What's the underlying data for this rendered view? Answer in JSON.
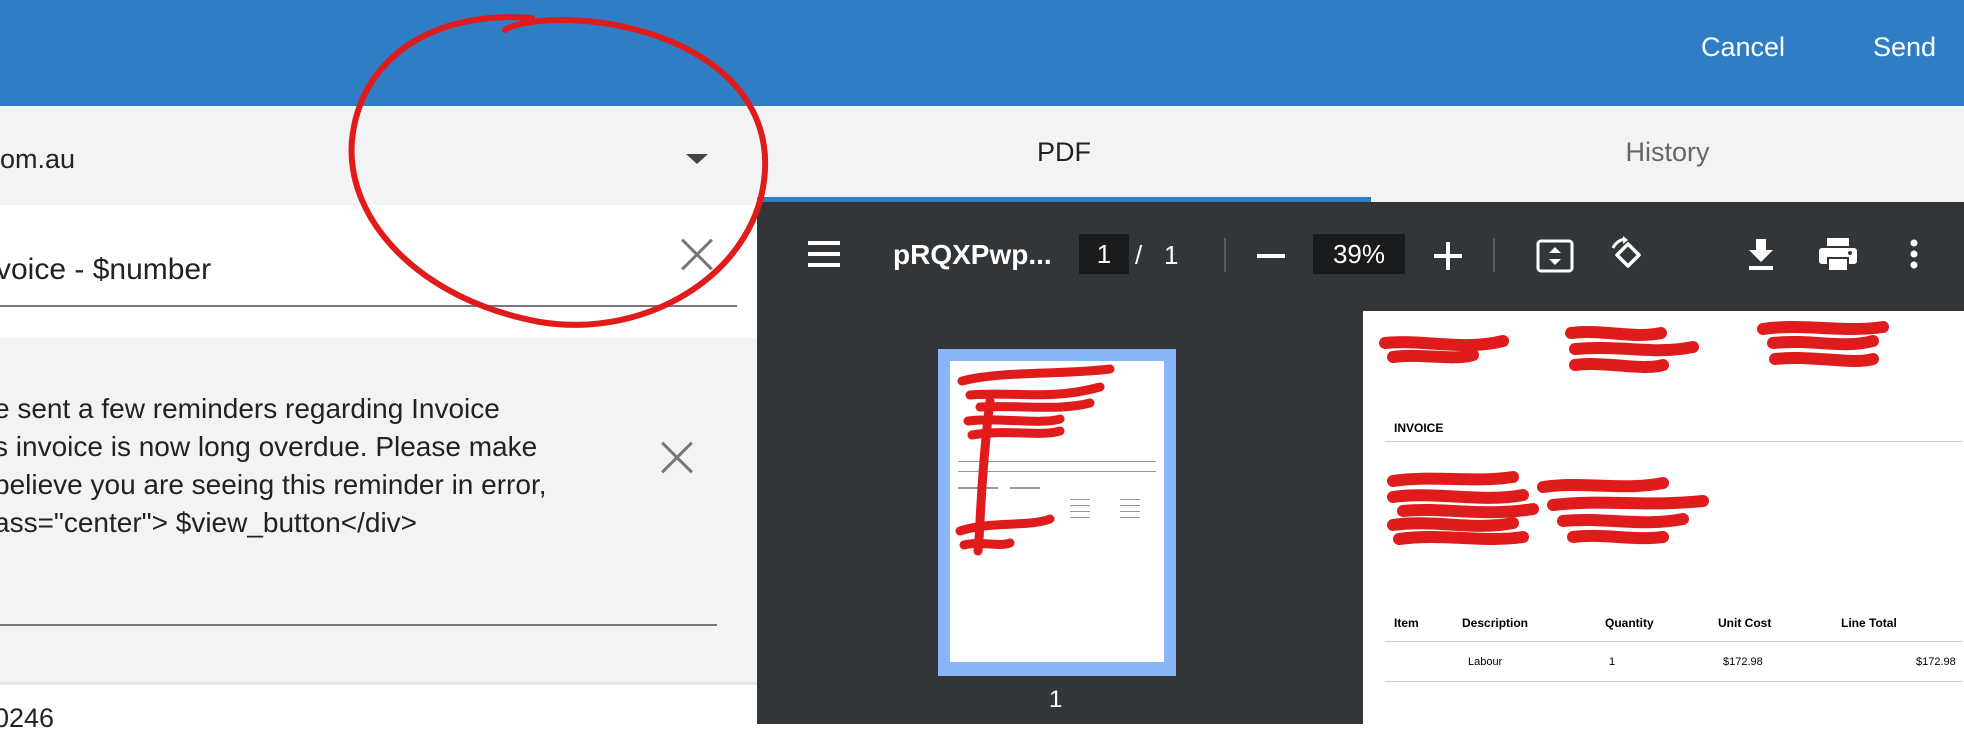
{
  "header": {
    "cancel_label": "Cancel",
    "send_label": "Send"
  },
  "form": {
    "to_value": "om.au",
    "subject_value": "voice - $number",
    "body_text": "e sent a few reminders regarding Invoice\ns invoice is now long overdue. Please make\nbelieve you are seeing this reminder in error,\nass=\"center\"> $view_button</div>",
    "bottom_value": "0246"
  },
  "tabs": [
    {
      "label": "PDF",
      "active": true
    },
    {
      "label": "History",
      "active": false
    }
  ],
  "pdf_viewer": {
    "filename": "pRQXPwp...",
    "page_current": "1",
    "page_separator": "/",
    "page_total": "1",
    "zoom": "39%",
    "thumbnail_page_number": "1",
    "icons": [
      "menu-icon",
      "zoom-out-icon",
      "zoom-in-icon",
      "fit-page-icon",
      "rotate-icon",
      "download-icon",
      "print-icon",
      "more-vert-icon"
    ]
  },
  "invoice_preview": {
    "heading": "INVOICE",
    "table_headers": [
      "Item",
      "Description",
      "Quantity",
      "Unit Cost",
      "Line Total"
    ],
    "rows": [
      {
        "item": "",
        "description": "Labour",
        "quantity": "1",
        "unit_cost": "$172.98",
        "line_total": "$172.98"
      }
    ]
  },
  "colors": {
    "primary": "#2f7dc5",
    "annotation_red": "#e01b1b",
    "viewer_bg": "#333639"
  }
}
